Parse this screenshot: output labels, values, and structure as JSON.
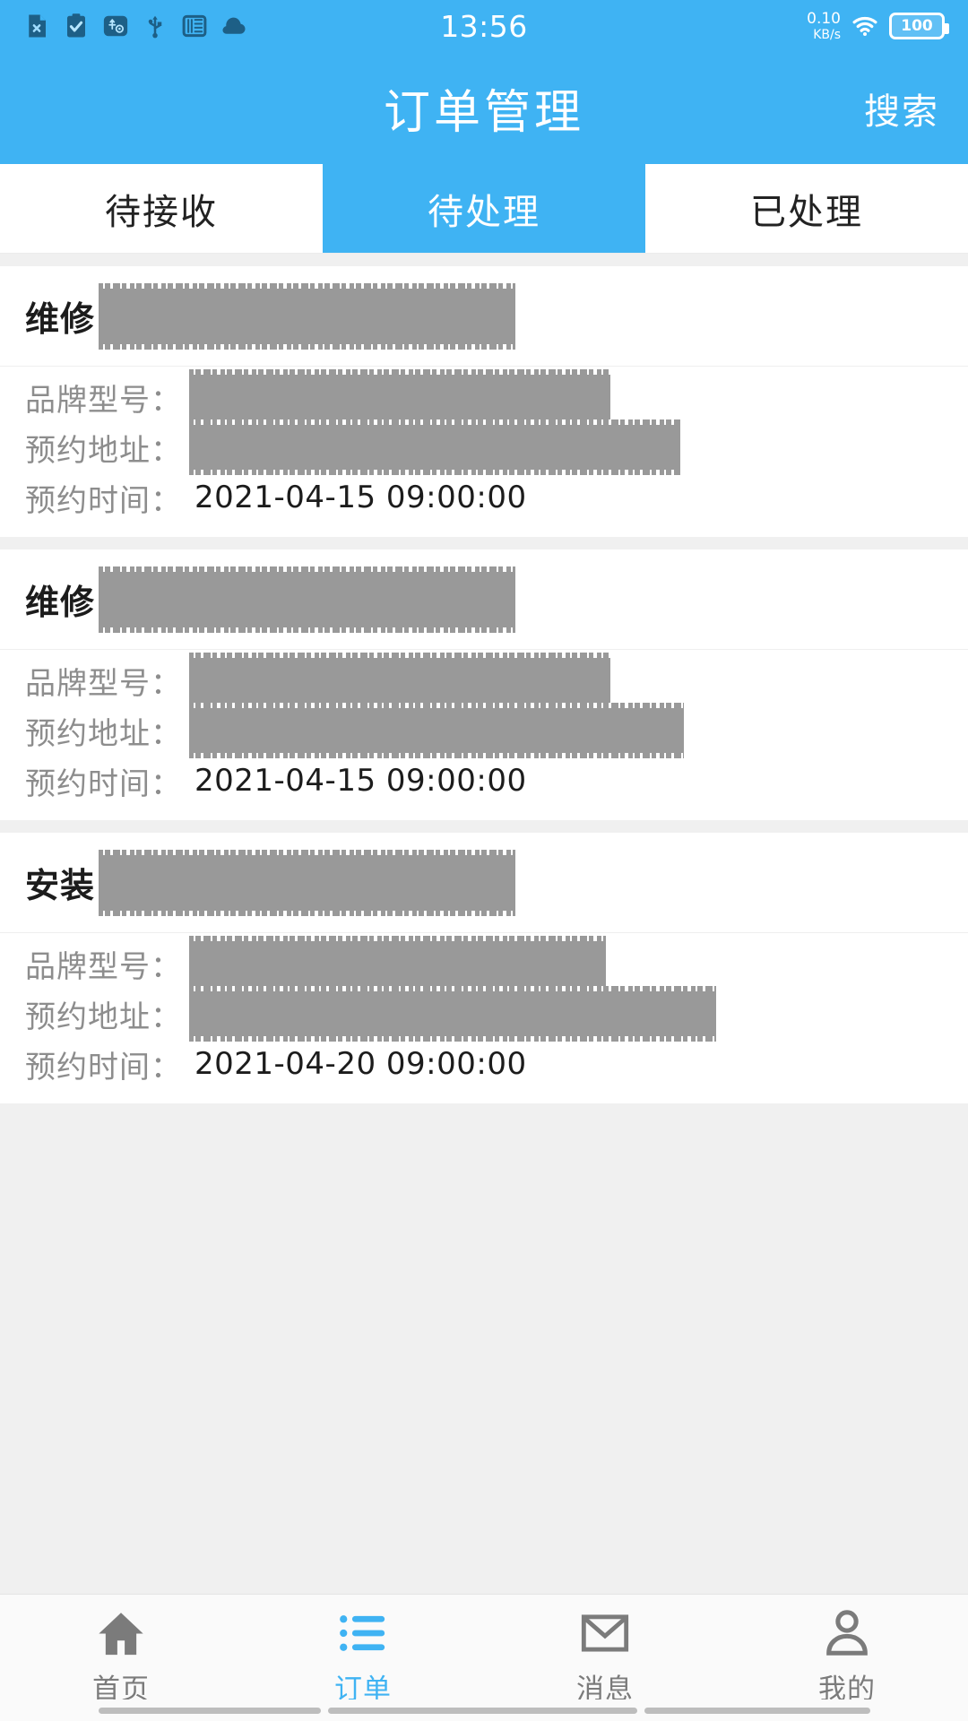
{
  "status_bar": {
    "clock": "13:56",
    "network_speed_value": "0.10",
    "network_speed_unit": "KB/s",
    "battery_level": "100",
    "left_icons": [
      {
        "name": "document-error-icon"
      },
      {
        "name": "clipboard-check-icon"
      },
      {
        "name": "usb-debug-settings-icon"
      },
      {
        "name": "usb-icon"
      },
      {
        "name": "wei-app-icon"
      },
      {
        "name": "cloud-icon"
      }
    ],
    "right_icons": [
      {
        "name": "wifi-icon"
      },
      {
        "name": "battery-icon"
      }
    ],
    "accent_color": "#3fb3f3"
  },
  "app_bar": {
    "title": "订单管理",
    "search_label": "搜索",
    "background_color": "#3fb3f3",
    "text_color": "#ffffff"
  },
  "tabs": {
    "active_index": 1,
    "active_background": "#3fb3f3",
    "items": [
      {
        "label": "待接收"
      },
      {
        "label": "待处理"
      },
      {
        "label": "已处理"
      }
    ]
  },
  "field_labels": {
    "brand_model": "品牌型号：",
    "appointment_address": "预约地址：",
    "appointment_time": "预约时间："
  },
  "orders": [
    {
      "type": "维修",
      "title_redacted_width": 465,
      "brand_model_value": "",
      "brand_model_redacted_width": 470,
      "address_value": "",
      "address_redacted_width": 548,
      "appointment_time_value": "2021-04-15 09:00:00"
    },
    {
      "type": "维修",
      "title_redacted_width": 465,
      "brand_model_value": "",
      "brand_model_redacted_width": 470,
      "address_value": "",
      "address_redacted_width": 552,
      "appointment_time_value": "2021-04-15 09:00:00"
    },
    {
      "type": "安装",
      "title_redacted_width": 465,
      "brand_model_value": "",
      "brand_model_redacted_width": 465,
      "address_value": "",
      "address_redacted_width": 588,
      "appointment_time_value": "2021-04-20 09:00:00"
    }
  ],
  "bottom_nav": {
    "active_index": 1,
    "active_color": "#3fb3f3",
    "inactive_color": "#7b7b7b",
    "items": [
      {
        "label": "首页",
        "icon": "home-icon"
      },
      {
        "label": "订单",
        "icon": "list-icon"
      },
      {
        "label": "消息",
        "icon": "envelope-icon"
      },
      {
        "label": "我的",
        "icon": "person-icon"
      }
    ]
  }
}
